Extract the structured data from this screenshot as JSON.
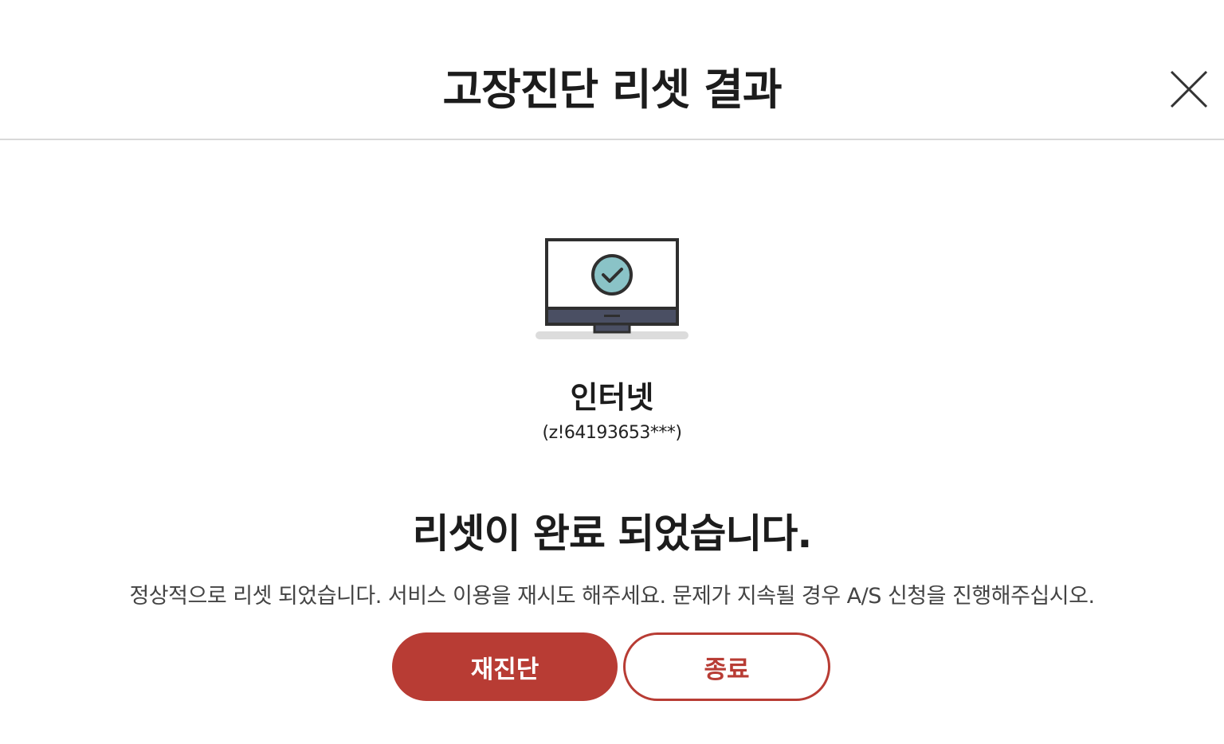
{
  "header": {
    "title": "고장진단 리셋 결과"
  },
  "service": {
    "name": "인터넷",
    "id": "(z!64193653***)"
  },
  "result": {
    "heading": "리셋이 완료 되었습니다.",
    "description": "정상적으로 리셋 되었습니다. 서비스 이용을 재시도 해주세요. 문제가 지속될 경우 A/S 신청을 진행해주십시오."
  },
  "buttons": {
    "rediagnose_label": "재진단",
    "close_label": "종료"
  },
  "icons": {
    "close": "close-icon",
    "monitor": "monitor-check-icon"
  },
  "colors": {
    "accent": "#b83c34",
    "check_circle": "#8ac3c7",
    "monitor_frame": "#2f2f2f",
    "monitor_base": "#4a4f63"
  }
}
